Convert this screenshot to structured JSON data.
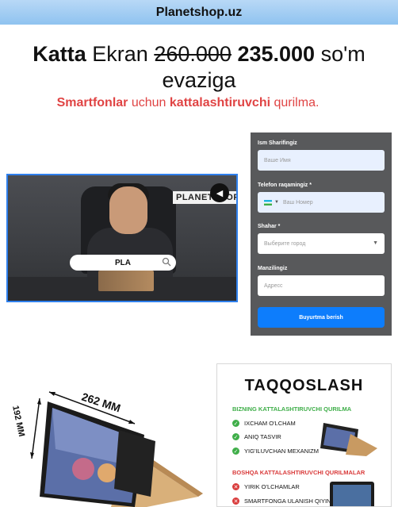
{
  "header": {
    "brand": "Planetshop.uz"
  },
  "hero": {
    "w1": "Katta",
    "w2": "Ekran",
    "old_price": "260.000",
    "new_price": "235.000",
    "currency": "so'm",
    "tail": "evaziga",
    "sub_bold1": "Smartfonlar",
    "sub_mid": "uchun",
    "sub_bold2": "kattalashtiruvchi",
    "sub_end": "qurilma."
  },
  "video": {
    "watermark": "PLANETSHOP.UZ",
    "search_text": "PLA"
  },
  "form": {
    "name_label": "Ism Sharifingiz",
    "name_placeholder": "Ваше Имя",
    "phone_label": "Telefon raqamingiz *",
    "phone_placeholder": "Ваш Номер",
    "city_label": "Shahar *",
    "city_placeholder": "Выберите город",
    "address_label": "Manzilingiz",
    "address_placeholder": "Адресс",
    "submit_label": "Buyurtma berish"
  },
  "product": {
    "dim_width": "262 MM",
    "dim_height": "192 MM"
  },
  "compare": {
    "title": "TAQQOSLASH",
    "good_title": "BIZNING KATTALASHTIRUVCHI QURILMA",
    "good_items": [
      "IXCHAM O'LCHAM",
      "ANIQ TASVIR",
      "YIG'ILUVCHAN MEXANIZM"
    ],
    "bad_title": "BOSHQA KATTALASHTIRUVCHI QURILMALAR",
    "bad_items": [
      "YIRIK O'LCHAMLAR",
      "SMARTFONGA ULANISH QIYINLIGI"
    ]
  }
}
